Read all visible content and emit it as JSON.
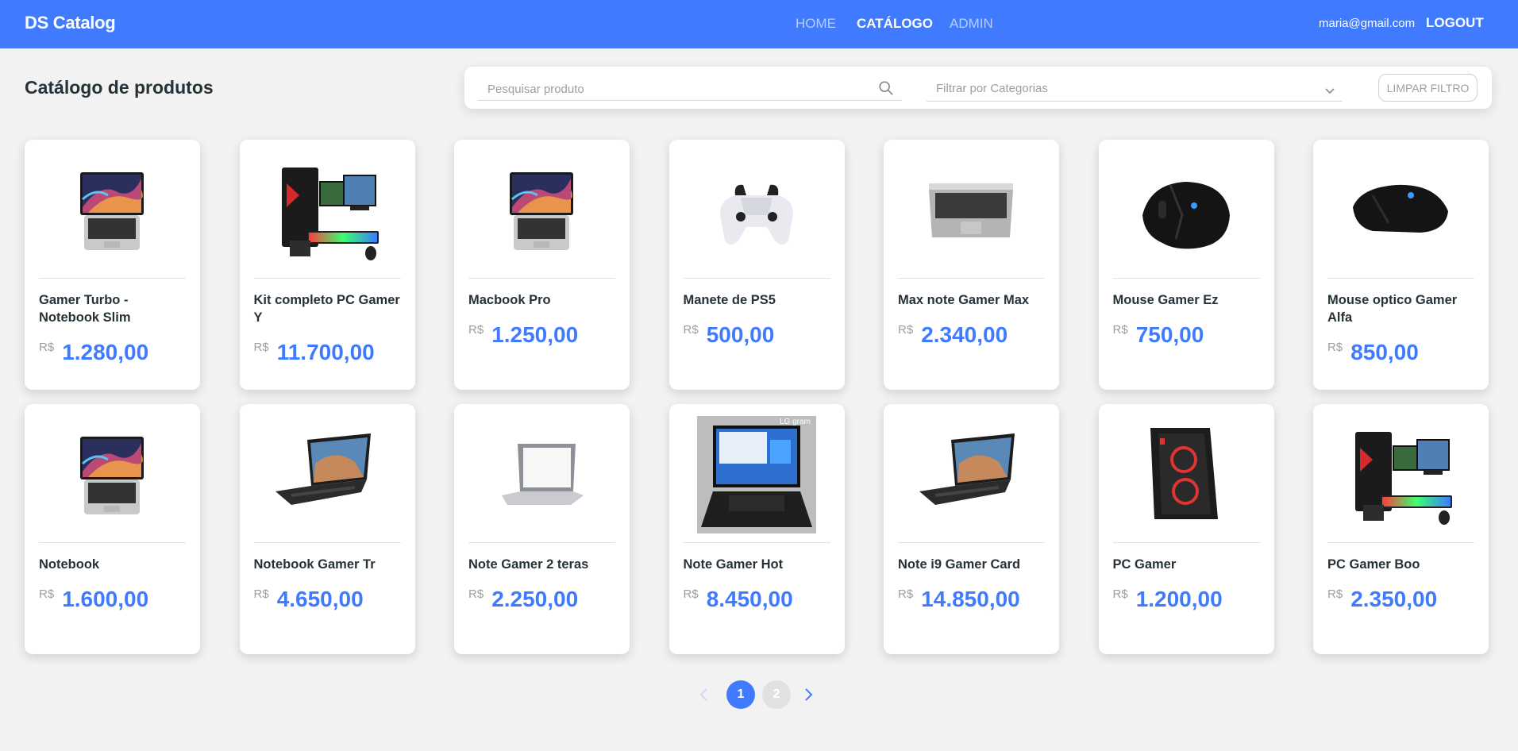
{
  "navbar": {
    "brand": "DS Catalog",
    "links": [
      {
        "label": "HOME"
      },
      {
        "label": "CATÁLOGO"
      },
      {
        "label": "ADMIN"
      }
    ],
    "user_email": "maria@gmail.com",
    "logout_label": "LOGOUT"
  },
  "page": {
    "title": "Catálogo de produtos"
  },
  "filters": {
    "search_placeholder": "Pesquisar produto",
    "category_placeholder": "Filtrar por Categorias",
    "clear_label": "LIMPAR FILTRO"
  },
  "products": [
    {
      "name": "Gamer Turbo - Notebook Slim",
      "currency": "R$",
      "price": "1.280,00",
      "image": "laptop-macbook"
    },
    {
      "name": "Kit completo PC Gamer Y",
      "currency": "R$",
      "price": "11.700,00",
      "image": "pc-gamer-kit"
    },
    {
      "name": "Macbook Pro",
      "currency": "R$",
      "price": "1.250,00",
      "image": "laptop-macbook"
    },
    {
      "name": "Manete de PS5",
      "currency": "R$",
      "price": "500,00",
      "image": "ps5-controller"
    },
    {
      "name": "Max note Gamer Max",
      "currency": "R$",
      "price": "2.340,00",
      "image": "laptop-silver"
    },
    {
      "name": "Mouse Gamer Ez",
      "currency": "R$",
      "price": "750,00",
      "image": "gaming-mouse"
    },
    {
      "name": "Mouse optico Gamer Alfa",
      "currency": "R$",
      "price": "850,00",
      "image": "gaming-mouse-side"
    },
    {
      "name": "Notebook",
      "currency": "R$",
      "price": "1.600,00",
      "image": "laptop-macbook"
    },
    {
      "name": "Notebook Gamer Tr",
      "currency": "R$",
      "price": "4.650,00",
      "image": "laptop-angled"
    },
    {
      "name": "Note Gamer 2 teras",
      "currency": "R$",
      "price": "2.250,00",
      "image": "laptop-white"
    },
    {
      "name": "Note Gamer Hot",
      "currency": "R$",
      "price": "8.450,00",
      "image": "laptop-lg-gram"
    },
    {
      "name": "Note i9 Gamer Card",
      "currency": "R$",
      "price": "14.850,00",
      "image": "laptop-angled"
    },
    {
      "name": "PC Gamer",
      "currency": "R$",
      "price": "1.200,00",
      "image": "pc-tower"
    },
    {
      "name": "PC Gamer Boo",
      "currency": "R$",
      "price": "2.350,00",
      "image": "pc-gamer-kit"
    }
  ],
  "pagination": {
    "pages": [
      "1",
      "2"
    ],
    "current": "1"
  },
  "lg_logo_text": "LG gram",
  "colors": {
    "primary": "#407bff",
    "background": "#f2f2f2",
    "text": "#263238",
    "muted": "#9e9e9e"
  }
}
